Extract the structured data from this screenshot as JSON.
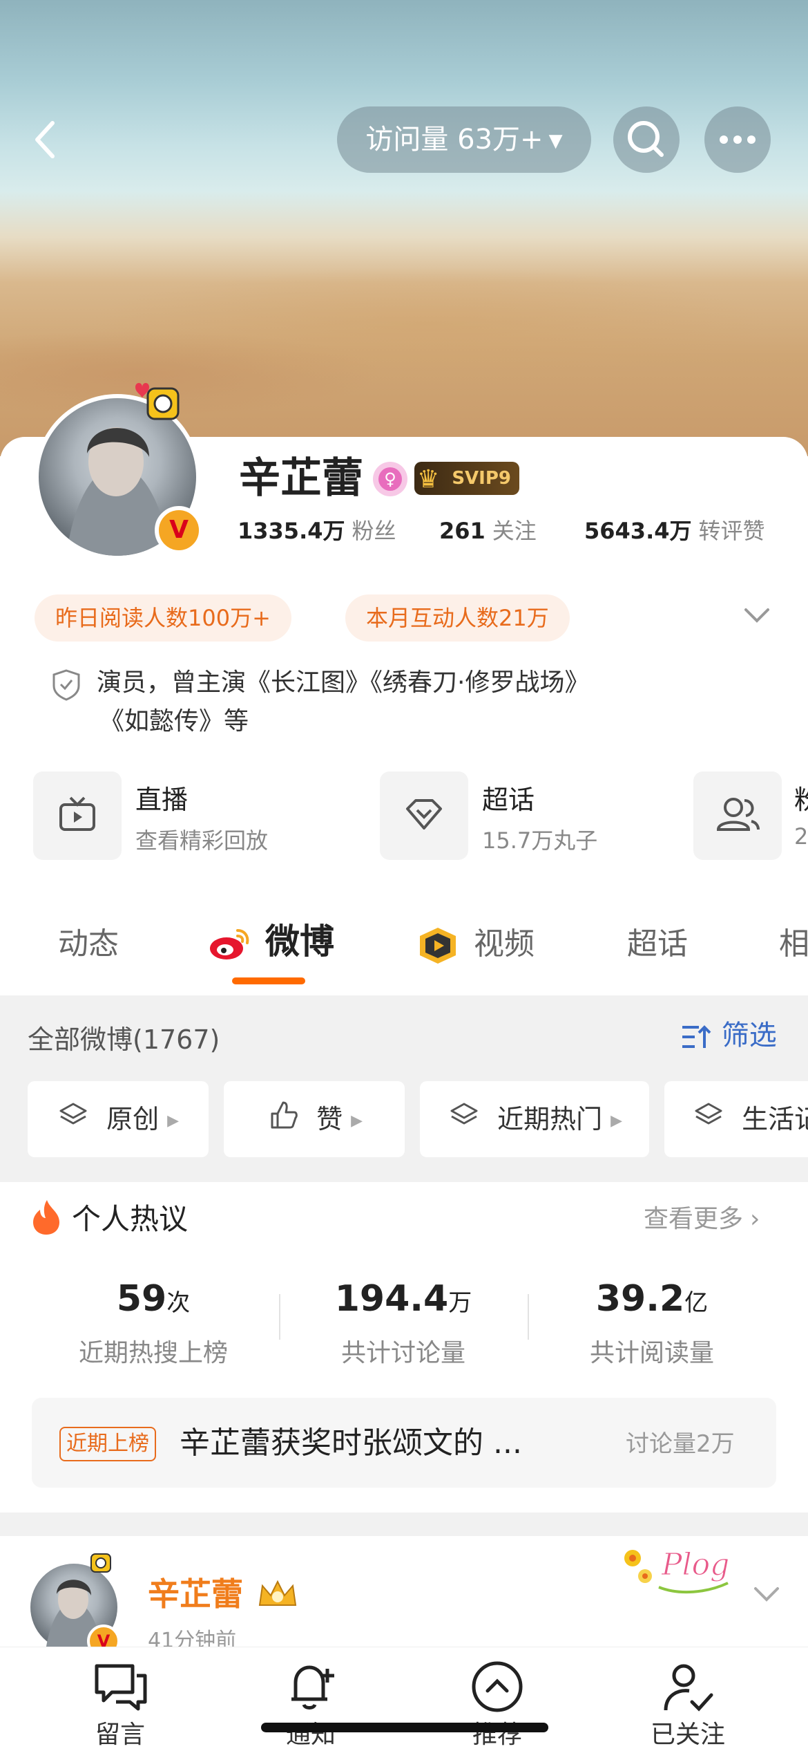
{
  "header": {
    "visits_label": "访问量 63万+",
    "back_icon": "back-arrow-icon",
    "search_icon": "search-icon",
    "more_icon": "more-dots-icon"
  },
  "profile": {
    "name": "辛芷蕾",
    "vip": "SVIP9",
    "verified_badge": "V",
    "stats": [
      {
        "num": "1335.4万",
        "label": "粉丝"
      },
      {
        "num": "261",
        "label": "关注"
      },
      {
        "num": "5643.4万",
        "label": "转评赞"
      }
    ],
    "pills": [
      "昨日阅读人数100万+",
      "本月互动人数21万"
    ],
    "bio_line1": "演员，曾主演《长江图》《绣春刀·修罗战场》",
    "bio_line2": "《如懿传》等",
    "quick": [
      {
        "title": "直播",
        "sub": "查看精彩回放",
        "icon": "tv-icon"
      },
      {
        "title": "超话",
        "sub": "15.7万丸子",
        "icon": "diamond-icon"
      },
      {
        "title": "粉",
        "sub": "2",
        "icon": "group-icon"
      }
    ]
  },
  "tabs": [
    "动态",
    "微博",
    "视频",
    "超话",
    "相"
  ],
  "feed": {
    "count_label": "全部微博(1767)",
    "filter_label": "筛选",
    "chips": [
      "原创",
      "赞",
      "近期热门",
      "生活记"
    ]
  },
  "hot": {
    "title": "个人热议",
    "more": "查看更多",
    "stats": [
      {
        "num": "59",
        "unit": "次",
        "label": "近期热搜上榜"
      },
      {
        "num": "194.4",
        "unit": "万",
        "label": "共计讨论量"
      },
      {
        "num": "39.2",
        "unit": "亿",
        "label": "共计阅读量"
      }
    ],
    "trend_tag": "近期上榜",
    "trend_text": "辛芷蕾获奖时张颂文的 ...",
    "trend_count": "讨论量2万"
  },
  "post": {
    "name": "辛芷蕾",
    "time": "41分钟前",
    "sticker": "Plog"
  },
  "bottom": [
    "留言",
    "通知",
    "推荐",
    "已关注"
  ],
  "colors": {
    "accent": "#ff6a00",
    "name_orange": "#f07d1c",
    "link_blue": "#3a6cc7",
    "pill_bg": "#fdf0e8"
  }
}
